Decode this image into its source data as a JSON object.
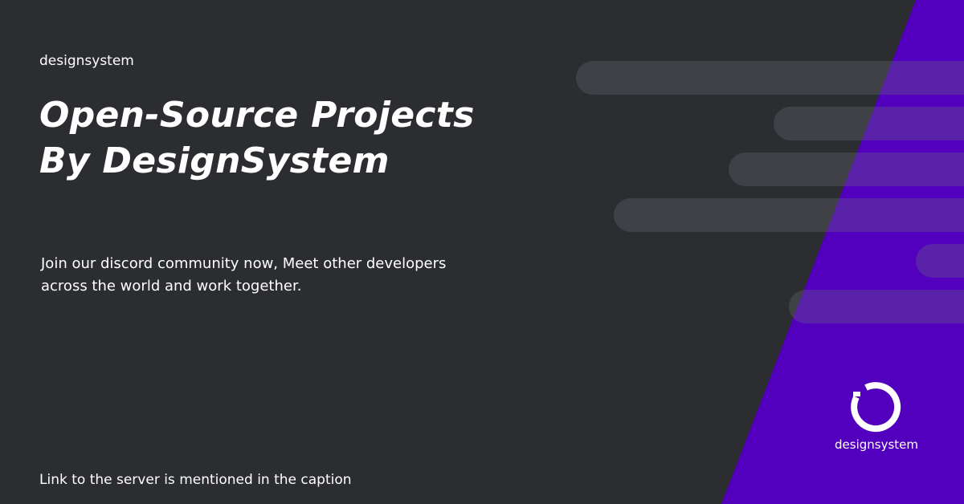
{
  "brand": {
    "name_small": "designsystem",
    "logo_wordmark": "designsystem"
  },
  "headline": {
    "line1": "Open-Source Projects",
    "line2": "By DesignSystem"
  },
  "description": {
    "line1": "Join our discord community now, Meet other developers",
    "line2": "across the world and work together."
  },
  "footer": {
    "note": "Link to the server is mentioned in the caption"
  },
  "colors": {
    "background": "#2b2d31",
    "accent": "#5200bd",
    "text": "#ffffff",
    "bar": "#3b3d44"
  },
  "icons": {
    "logo": "circle-refresh-icon"
  }
}
